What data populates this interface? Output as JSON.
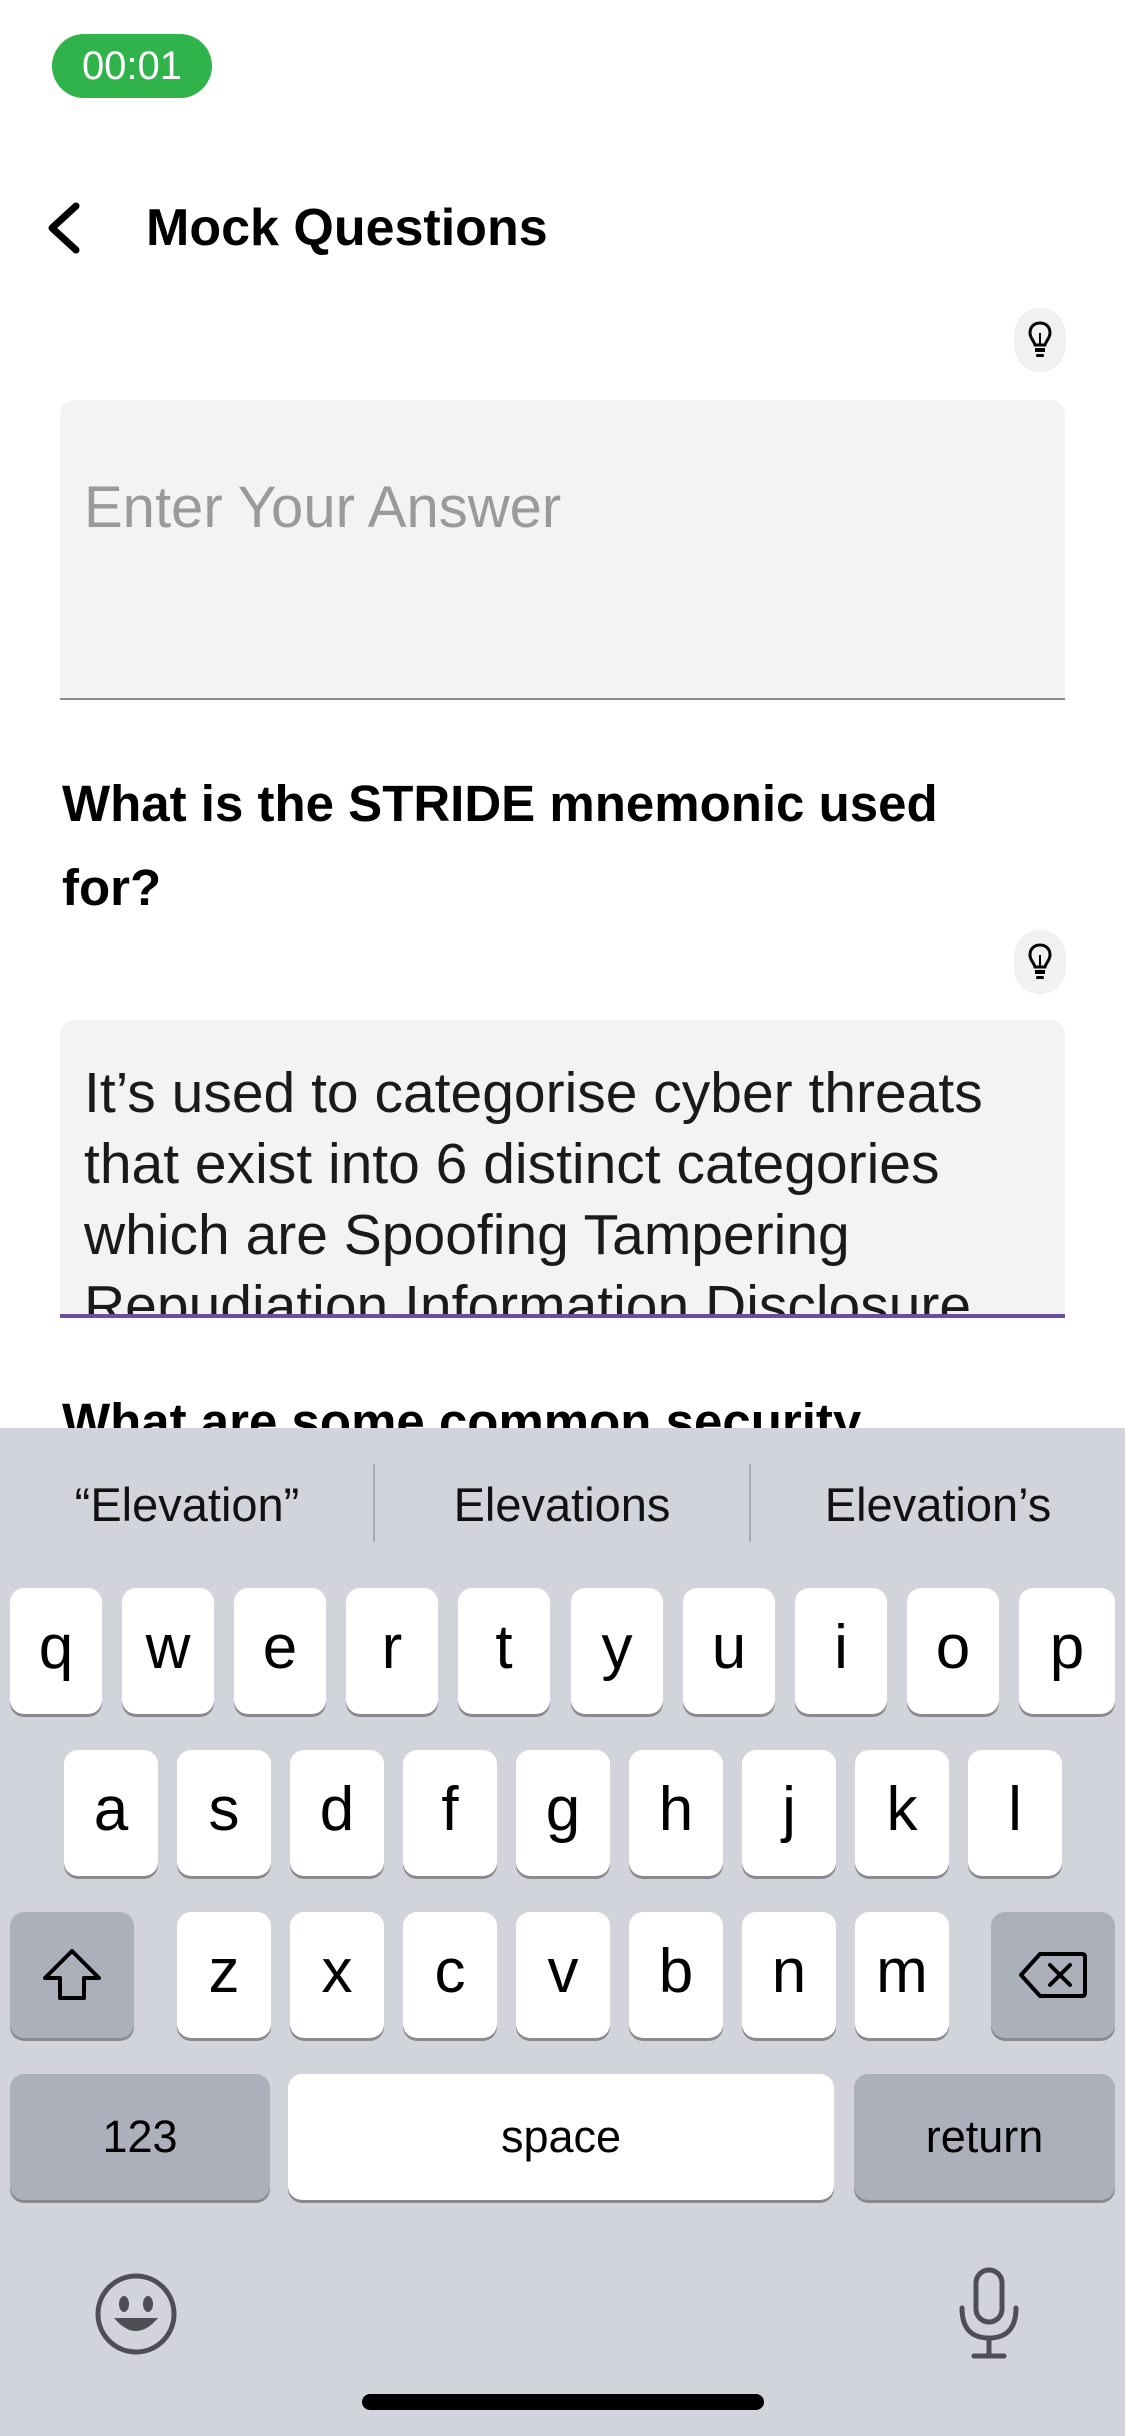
{
  "status": {
    "timer": "00:01",
    "timer_color": "#2fb34a"
  },
  "header": {
    "title": "Mock Questions",
    "back_icon": "chevron-left-icon"
  },
  "questions": [
    {
      "text": "",
      "answer_placeholder": "Enter Your Answer",
      "answer_value": ""
    },
    {
      "text": "What is the STRIDE mnemonic used for?",
      "answer_placeholder": "Enter Your Answer",
      "answer_value": "It’s used to categorise cyber threats that exist into 6 distinct categories which are Spoofing Tampering Repudiation Information Disclosure"
    },
    {
      "text": "What are some common security"
    }
  ],
  "hint_icon": "lightbulb-icon",
  "accent_color": "#6b4ea2",
  "keyboard": {
    "suggestions": [
      "“Elevation”",
      "Elevations",
      "Elevation’s"
    ],
    "row1": [
      "q",
      "w",
      "e",
      "r",
      "t",
      "y",
      "u",
      "i",
      "o",
      "p"
    ],
    "row2": [
      "a",
      "s",
      "d",
      "f",
      "g",
      "h",
      "j",
      "k",
      "l"
    ],
    "row3": [
      "z",
      "x",
      "c",
      "v",
      "b",
      "n",
      "m"
    ],
    "shift_icon": "shift-icon",
    "delete_icon": "delete-icon",
    "numbers_label": "123",
    "space_label": "space",
    "return_label": "return",
    "emoji_icon": "emoji-icon",
    "mic_icon": "microphone-icon"
  }
}
